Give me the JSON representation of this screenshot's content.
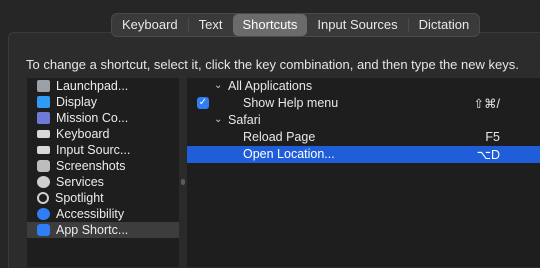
{
  "tabs": [
    {
      "label": "Keyboard",
      "active": false
    },
    {
      "label": "Text",
      "active": false
    },
    {
      "label": "Shortcuts",
      "active": true
    },
    {
      "label": "Input Sources",
      "active": false
    },
    {
      "label": "Dictation",
      "active": false
    }
  ],
  "description": "To change a shortcut, select it, click the key combination, and then type the new keys.",
  "categories": [
    {
      "label": "Launchpad...",
      "icon": "launchpad-icon",
      "color": "#9aa0a6"
    },
    {
      "label": "Display",
      "icon": "display-icon",
      "color": "#2f9bf5"
    },
    {
      "label": "Mission Co...",
      "icon": "mission-control-icon",
      "color": "#6e7bd6"
    },
    {
      "label": "Keyboard",
      "icon": "keyboard-icon",
      "color": "#d8d8d8"
    },
    {
      "label": "Input Sourc...",
      "icon": "input-sources-icon",
      "color": "#d8d8d8"
    },
    {
      "label": "Screenshots",
      "icon": "screenshots-icon",
      "color": "#bdbdbd"
    },
    {
      "label": "Services",
      "icon": "gear-icon",
      "color": "#cfcfcf"
    },
    {
      "label": "Spotlight",
      "icon": "spotlight-icon",
      "color": "#cfcfcf"
    },
    {
      "label": "Accessibility",
      "icon": "accessibility-icon",
      "color": "#2f7ef6"
    },
    {
      "label": "App Shortc...",
      "icon": "app-store-icon",
      "color": "#2f7ef6",
      "selected": true
    }
  ],
  "shortcuts": {
    "group1": {
      "label": "All Applications"
    },
    "help": {
      "label": "Show Help menu",
      "keys": "⇧⌘/",
      "checked": true
    },
    "group2": {
      "label": "Safari"
    },
    "reload": {
      "label": "Reload Page",
      "keys": "F5"
    },
    "open": {
      "label": "Open Location...",
      "keys": "⌥D",
      "selected": true
    }
  },
  "colors": {
    "selection": "#1f5ed8",
    "accent": "#2f7ef6"
  }
}
